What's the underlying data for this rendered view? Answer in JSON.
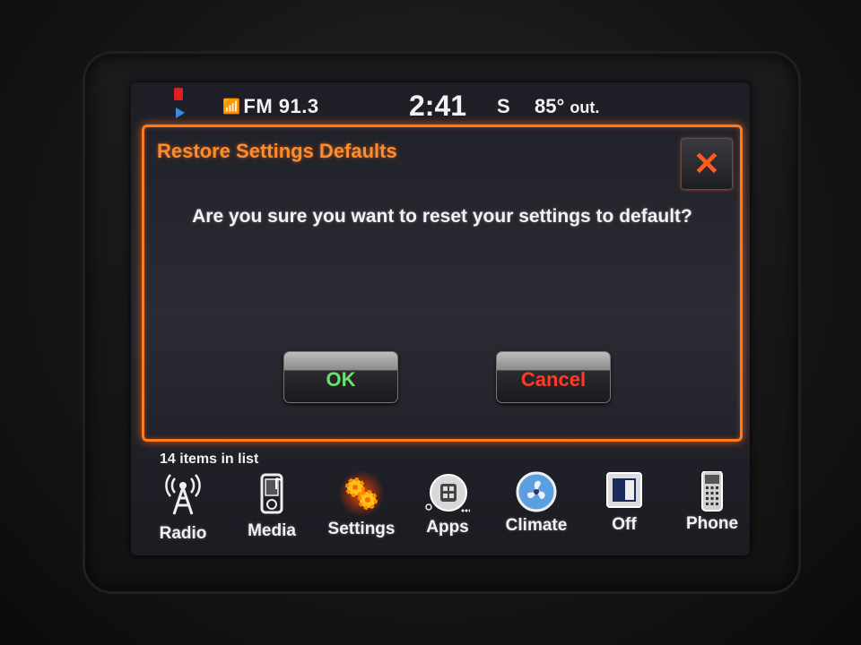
{
  "status_bar": {
    "radio": "FM 91.3",
    "time": "2:41",
    "compass": "S",
    "temperature": "85°",
    "temperature_suffix": "out."
  },
  "dialog": {
    "title": "Restore Settings Defaults",
    "message": "Are you sure you want to reset your settings to default?",
    "close_icon": "✕",
    "ok_label": "OK",
    "cancel_label": "Cancel"
  },
  "list_info": "14 items in list",
  "nav": {
    "items": [
      {
        "label": "Radio",
        "icon": "radio-tower-icon"
      },
      {
        "label": "Media",
        "icon": "media-player-icon"
      },
      {
        "label": "Settings",
        "icon": "gears-icon",
        "active": true
      },
      {
        "label": "Apps",
        "icon": "apps-icon"
      },
      {
        "label": "Climate",
        "icon": "climate-fan-icon"
      },
      {
        "label": "Off",
        "icon": "screen-off-icon"
      },
      {
        "label": "Phone",
        "icon": "phone-icon"
      }
    ]
  },
  "colors": {
    "accent": "#ff7a1f",
    "ok": "#6fe06f",
    "cancel": "#ff3a28"
  }
}
